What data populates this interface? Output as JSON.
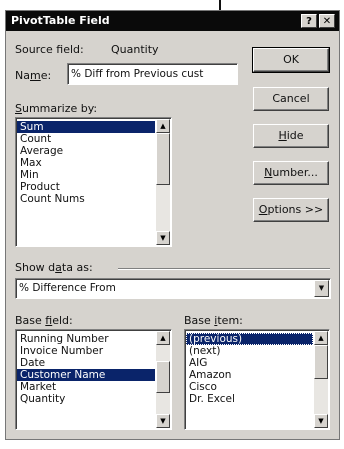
{
  "dialog": {
    "title": "PivotTable Field",
    "help_glyph": "?",
    "close_glyph": "✕"
  },
  "source_field": {
    "label": "Source field:",
    "value": "Quantity"
  },
  "name": {
    "label_underlined": "Na",
    "label_key": "m",
    "label_rest": "e:",
    "value": "% Diff from Previous cust"
  },
  "summarize": {
    "label_key": "S",
    "label_rest": "ummarize by:",
    "items": [
      "Sum",
      "Count",
      "Average",
      "Max",
      "Min",
      "Product",
      "Count Nums"
    ],
    "selected_index": 0
  },
  "buttons": {
    "ok": "OK",
    "cancel": "Cancel",
    "hide_key": "H",
    "hide_rest": "ide",
    "number_key": "N",
    "number_rest": "umber...",
    "options_key": "O",
    "options_rest": "ptions >>"
  },
  "show_data_as": {
    "label_pre": "Show d",
    "label_key": "a",
    "label_rest": "ta as:",
    "value": "% Difference From"
  },
  "base_field": {
    "label_pre": "Base ",
    "label_key": "f",
    "label_rest": "ield:",
    "items": [
      "Running Number",
      "Invoice Number",
      "Date",
      "Customer Name",
      "Market",
      "Quantity"
    ],
    "selected_index": 3
  },
  "base_item": {
    "label_pre": "Base ",
    "label_key": "i",
    "label_rest": "tem:",
    "items": [
      "(previous)",
      "(next)",
      "AIG",
      "Amazon",
      "Cisco",
      "Dr. Excel"
    ],
    "selected_index": 0
  },
  "scroll": {
    "up": "▲",
    "down": "▼"
  }
}
